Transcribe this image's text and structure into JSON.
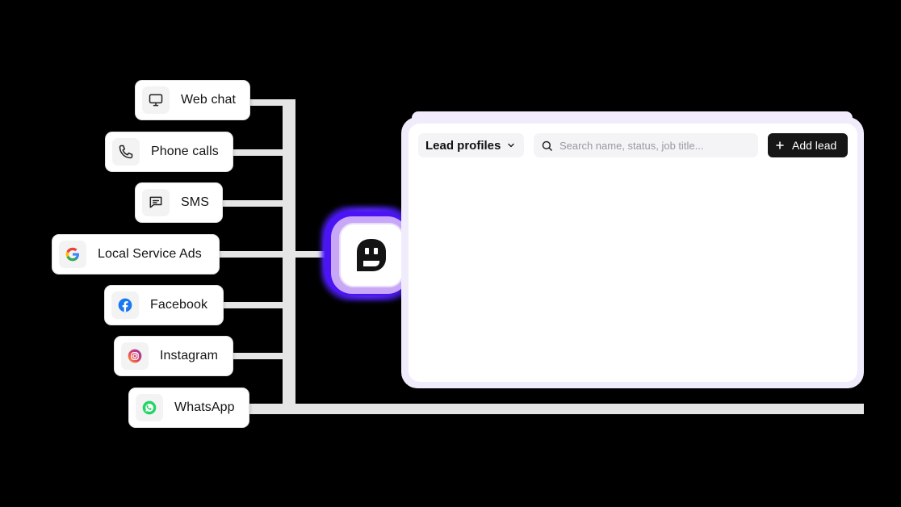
{
  "channels": [
    {
      "label": "Web chat",
      "icon": "monitor-icon"
    },
    {
      "label": "Phone calls",
      "icon": "phone-icon"
    },
    {
      "label": "SMS",
      "icon": "message-icon"
    },
    {
      "label": "Local Service Ads",
      "icon": "google-icon"
    },
    {
      "label": "Facebook",
      "icon": "facebook-icon"
    },
    {
      "label": "Instagram",
      "icon": "instagram-icon"
    },
    {
      "label": "WhatsApp",
      "icon": "whatsapp-icon"
    }
  ],
  "panel": {
    "dropdown_label": "Lead profiles",
    "search_placeholder": "Search name, status, job title...",
    "add_button_label": "Add lead"
  },
  "colors": {
    "background": "#000000",
    "connector": "#e5e5e5",
    "glow": "#4a14f5",
    "panel_frame": "#f1ecfb",
    "button": "#161616",
    "facebook": "#1877f2",
    "whatsapp": "#25d366"
  }
}
